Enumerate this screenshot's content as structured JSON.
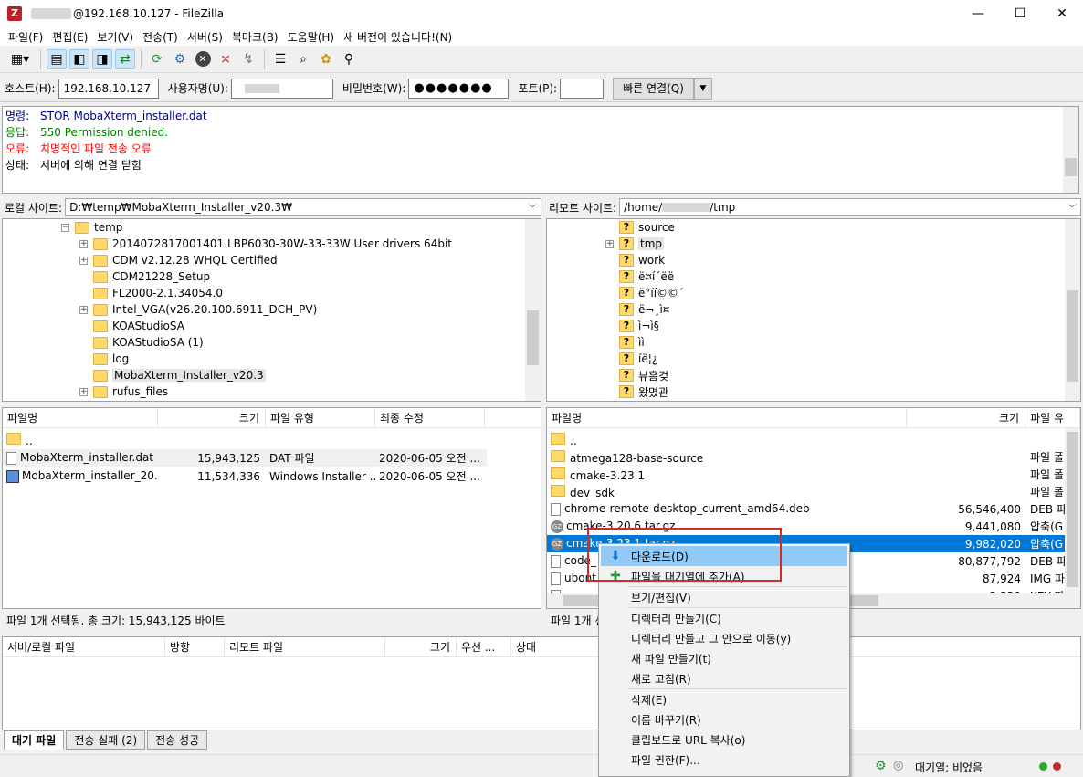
{
  "window": {
    "title": "@192.168.10.127 - FileZilla",
    "controls": {
      "minimize": "—",
      "maximize": "☐",
      "close": "✕"
    }
  },
  "menu": [
    "파일(F)",
    "편집(E)",
    "보기(V)",
    "전송(T)",
    "서버(S)",
    "북마크(B)",
    "도움말(H)",
    "새 버전이 있습니다!(N)"
  ],
  "quickconnect": {
    "host_label": "호스트(H):",
    "host_value": "192.168.10.127",
    "user_label": "사용자명(U):",
    "user_value": "",
    "pass_label": "비밀번호(W):",
    "pass_value": "●●●●●●●",
    "port_label": "포트(P):",
    "port_value": "",
    "connect_label": "빠른 연결(Q)"
  },
  "log": [
    {
      "label": "명령:",
      "text": "STOR MobaXterm_installer.dat",
      "type": "cmd"
    },
    {
      "label": "응답:",
      "text": "550 Permission denied.",
      "type": "resp"
    },
    {
      "label": "오류:",
      "text": "치명적인 파일 전송 오류",
      "type": "err"
    },
    {
      "label": "상태:",
      "text": "서버에 의해 연결 닫힘",
      "type": "status"
    }
  ],
  "local": {
    "site_label": "로컬 사이트:",
    "path": "D:₩temp₩MobaXterm_Installer_v20.3₩",
    "tree_root": "temp",
    "tree": [
      {
        "name": "2014072817001401.LBP6030-30W-33-33W User drivers 64bit",
        "expand": true
      },
      {
        "name": "CDM v2.12.28 WHQL Certified",
        "expand": true
      },
      {
        "name": "CDM21228_Setup",
        "expand": false
      },
      {
        "name": "FL2000-2.1.34054.0",
        "expand": false
      },
      {
        "name": "Intel_VGA(v26.20.100.6911_DCH_PV)",
        "expand": true
      },
      {
        "name": "KOAStudioSA",
        "expand": false
      },
      {
        "name": "KOAStudioSA (1)",
        "expand": false
      },
      {
        "name": "log",
        "expand": false
      },
      {
        "name": "MobaXterm_Installer_v20.3",
        "expand": false
      },
      {
        "name": "rufus_files",
        "expand": true
      }
    ],
    "columns": [
      "파일명",
      "크기",
      "파일 유형",
      "최종 수정"
    ],
    "files": [
      {
        "name": "..",
        "size": "",
        "type": "",
        "modified": "",
        "icon": "folder"
      },
      {
        "name": "MobaXterm_installer.dat",
        "size": "15,943,125",
        "type": "DAT 파일",
        "modified": "2020-06-05 오전 ...",
        "icon": "file"
      },
      {
        "name": "MobaXterm_installer_20....",
        "size": "11,534,336",
        "type": "Windows Installer ...",
        "modified": "2020-06-05 오전 ...",
        "icon": "msi"
      }
    ],
    "status": "파일 1개 선택됨. 총 크기: 15,943,125 바이트"
  },
  "remote": {
    "site_label": "리모트 사이트:",
    "path_prefix": "/home/",
    "path_suffix": "/tmp",
    "tree": [
      {
        "name": "source",
        "expand": false
      },
      {
        "name": "tmp",
        "expand": true
      },
      {
        "name": "work",
        "expand": false
      },
      {
        "name": "ë¤í´ëë",
        "expand": false
      },
      {
        "name": "ë°íí©©´",
        "expand": false
      },
      {
        "name": "ë¬¸ì¤",
        "expand": false
      },
      {
        "name": "ì¬ì§",
        "expand": false
      },
      {
        "name": "ìì",
        "expand": false
      },
      {
        "name": "íë¦¿",
        "expand": false
      },
      {
        "name": "뷰흠겆",
        "expand": false
      },
      {
        "name": "왔몄관",
        "expand": false
      }
    ],
    "columns": [
      "파일명",
      "크기",
      "파일 유"
    ],
    "files": [
      {
        "name": "..",
        "size": "",
        "type": "",
        "icon": "folder"
      },
      {
        "name": "atmega128-base-source",
        "size": "",
        "type": "파일 폴",
        "icon": "folder"
      },
      {
        "name": "cmake-3.23.1",
        "size": "",
        "type": "파일 폴",
        "icon": "folder"
      },
      {
        "name": "dev_sdk",
        "size": "",
        "type": "파일 폴",
        "icon": "folder"
      },
      {
        "name": "chrome-remote-desktop_current_amd64.deb",
        "size": "56,546,400",
        "type": "DEB 파",
        "icon": "file"
      },
      {
        "name": "cmake-3.20.6.tar.gz",
        "size": "9,441,080",
        "type": "압축(G",
        "icon": "gz"
      },
      {
        "name": "cmake-3.23.1.tar.gz",
        "size": "9,982,020",
        "type": "압축(G",
        "icon": "gz",
        "selected": true
      },
      {
        "name": "code_",
        "size": "80,877,792",
        "type": "DEB 파",
        "icon": "file"
      },
      {
        "name": "ubont",
        "size": "87,924",
        "type": "IMG 파",
        "icon": "file"
      },
      {
        "name": "",
        "size": "2,330",
        "type": "KEY 파",
        "icon": "file"
      }
    ],
    "status": "파일 1개 선"
  },
  "queue": {
    "columns": [
      "서버/로컬 파일",
      "방향",
      "리모트 파일",
      "크기",
      "우선 ...",
      "상태"
    ]
  },
  "tabs": [
    "대기 파일",
    "전송 실패 (2)",
    "전송 성공"
  ],
  "statusbar": {
    "queue_text": "대기열: 비었음"
  },
  "context_menu": {
    "items": [
      {
        "label": "다운로드(D)",
        "icon": "download-icon",
        "glyph": "⬇",
        "highlight": true
      },
      {
        "label": "파일을 대기열에 추가(A)",
        "icon": "add-queue-icon",
        "glyph": "✚"
      },
      {
        "label": "보기/편집(V)",
        "sep_before": true
      },
      {
        "label": "디렉터리 만들기(C)",
        "sep_before": true
      },
      {
        "label": "디렉터리 만들고 그 안으로 이동(y)"
      },
      {
        "label": "새 파일 만들기(t)"
      },
      {
        "label": "새로 고침(R)"
      },
      {
        "label": "삭제(E)",
        "sep_before": true
      },
      {
        "label": "이름 바꾸기(R)"
      },
      {
        "label": "클립보드로 URL 복사(o)"
      },
      {
        "label": "파일 권한(F)..."
      }
    ]
  },
  "colors": {
    "selection": "#0078d7",
    "menu_highlight": "#91c9f7",
    "annotation_box": "#d42a2a",
    "log_command": "#000080",
    "log_response": "#008000",
    "log_error": "#ff0000"
  }
}
